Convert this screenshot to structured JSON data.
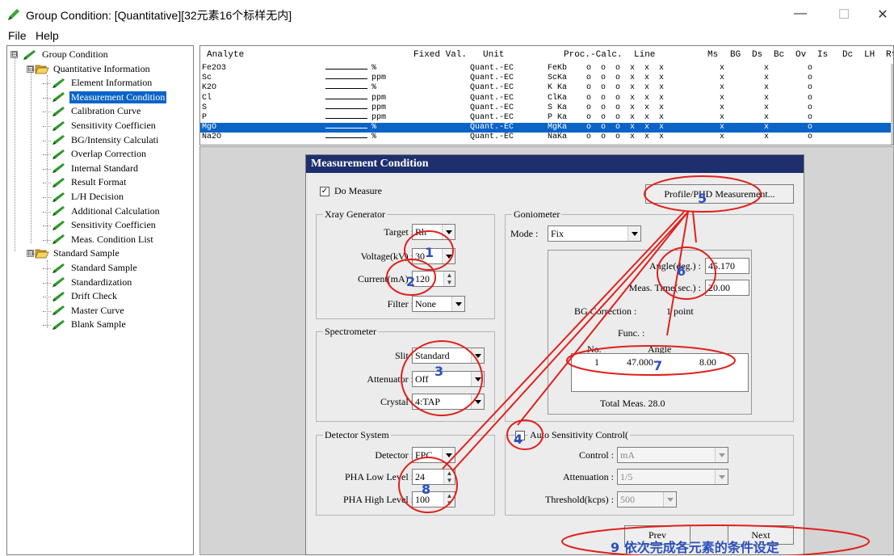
{
  "window": {
    "title": "Group Condition: [Quantitative][32元素16个标样无内]",
    "minimize": "—",
    "maximize": "☐",
    "close": "✕"
  },
  "menu": [
    "File",
    "Help"
  ],
  "tree": [
    {
      "label": "Group Condition",
      "icon": "pen-icon"
    },
    {
      "label": "Quantitative Information",
      "icon": "folder-open-icon"
    },
    {
      "label": "Element Information",
      "icon": "pen-icon"
    },
    {
      "label": "Measurement Condition",
      "icon": "pen-icon",
      "selected": true
    },
    {
      "label": "Calibration Curve",
      "icon": "pen-icon"
    },
    {
      "label": "Sensitivity Coefficien",
      "icon": "pen-icon"
    },
    {
      "label": "BG/Intensity Calculati",
      "icon": "pen-icon"
    },
    {
      "label": "Overlap Correction",
      "icon": "pen-icon"
    },
    {
      "label": "Internal Standard",
      "icon": "pen-icon"
    },
    {
      "label": "Result Format",
      "icon": "pen-icon"
    },
    {
      "label": "L/H Decision",
      "icon": "pen-icon"
    },
    {
      "label": "Additional Calculation",
      "icon": "pen-icon"
    },
    {
      "label": "Sensitivity Coefficien",
      "icon": "pen-icon"
    },
    {
      "label": "Meas. Condition List",
      "icon": "pen-icon"
    },
    {
      "label": "Standard Sample",
      "icon": "folder-open-icon"
    },
    {
      "label": "Standard Sample",
      "icon": "pen-icon"
    },
    {
      "label": "Standardization",
      "icon": "pen-icon"
    },
    {
      "label": "Drift Check",
      "icon": "pen-icon"
    },
    {
      "label": "Master Curve",
      "icon": "pen-icon"
    },
    {
      "label": "Blank Sample",
      "icon": "pen-icon"
    }
  ],
  "tree_expand": [
    "⊟",
    "⊟",
    "⊟"
  ],
  "grid": {
    "headers": [
      "Analyte",
      "Fixed Val.",
      "Unit",
      "Proc.-Calc.",
      "Line",
      "Ms",
      "BG",
      "Ds",
      "Bc",
      "Ov",
      "Is",
      "Dc",
      "LH",
      "Rf"
    ],
    "rows": [
      {
        "analyte": "Fe2O3",
        "unit": "%",
        "proc": "Quant.-EC",
        "line": "FeKb",
        "flags": "o  o  o  x  x  x",
        "ms": "x",
        "ds": "x",
        "ov": "o"
      },
      {
        "analyte": "Sc",
        "unit": "ppm",
        "proc": "Quant.-EC",
        "line": "ScKa",
        "flags": "o  o  o  x  x  x",
        "ms": "x",
        "ds": "x",
        "ov": "o"
      },
      {
        "analyte": "K2O",
        "unit": "%",
        "proc": "Quant.-EC",
        "line": "K Ka",
        "flags": "o  o  o  x  x  x",
        "ms": "x",
        "ds": "x",
        "ov": "o"
      },
      {
        "analyte": "Cl",
        "unit": "ppm",
        "proc": "Quant.-EC",
        "line": "ClKa",
        "flags": "o  o  o  x  x  x",
        "ms": "x",
        "ds": "x",
        "ov": "o"
      },
      {
        "analyte": "S",
        "unit": "ppm",
        "proc": "Quant.-EC",
        "line": "S Ka",
        "flags": "o  o  o  x  x  x",
        "ms": "x",
        "ds": "x",
        "ov": "o"
      },
      {
        "analyte": "P",
        "unit": "ppm",
        "proc": "Quant.-EC",
        "line": "P Ka",
        "flags": "o  o  o  x  x  x",
        "ms": "x",
        "ds": "x",
        "ov": "o"
      },
      {
        "analyte": "MgO",
        "unit": "%",
        "proc": "Quant.-EC",
        "line": "MgKa",
        "flags": "o  o  o  x  x  x",
        "ms": "x",
        "ds": "x",
        "ov": "o",
        "selected": true
      },
      {
        "analyte": "Na2O",
        "unit": "%",
        "proc": "Quant.-EC",
        "line": "NaKa",
        "flags": "o  o  o  x  x  x",
        "ms": "x",
        "ds": "x",
        "ov": "o"
      }
    ]
  },
  "dialog": {
    "title": "Measurement Condition",
    "do_measure_label": "Do Measure",
    "do_measure_checked": "✓",
    "profile_button": "Profile/PHD Measurement...",
    "xray": {
      "title": "Xray Generator",
      "target_label": "Target :",
      "target_value": "Rh",
      "voltage_label": "Voltage(kV) :",
      "voltage_value": "30",
      "current_label": "Current(mA) :",
      "current_value": "120",
      "filter_label": "Filter :",
      "filter_value": "None"
    },
    "spectrometer": {
      "title": "Spectrometer",
      "slit_label": "Slit :",
      "slit_value": "Standard",
      "attenuator_label": "Attenuator :",
      "attenuator_value": "Off",
      "crystal_label": "Crystal :",
      "crystal_value": "4:TAP"
    },
    "detector": {
      "title": "Detector System",
      "detector_label": "Detector :",
      "detector_value": "FPC",
      "pha_low_label": "PHA Low Level :",
      "pha_low_value": "24",
      "pha_high_label": "PHA High Level :",
      "pha_high_value": "100"
    },
    "goniometer": {
      "title": "Goniometer",
      "mode_label": "Mode :",
      "mode_value": "Fix",
      "angle_label": "Angle(deg.) :",
      "angle_value": "45.170",
      "meas_time_label": "Meas. Time(sec.) :",
      "meas_time_value": "20.00",
      "bg_corr_label": "BG Correction :",
      "bg_corr_value": "1 point",
      "func_label": "Func. :",
      "list_head_no": "No.",
      "list_head_angle": "Angle",
      "list_row_no": "1",
      "list_row_angle": "47.000",
      "list_row_time": "8.00",
      "total_meas": "Total Meas.  28.0"
    },
    "auto_sens": {
      "title": "Auto Sensitivity Control(",
      "control_label": "Control :",
      "control_value": "mA",
      "attenuation_label": "Attenuation :",
      "attenuation_value": "1/5",
      "threshold_label": "Threshold(kcps) :",
      "threshold_value": "500"
    },
    "prev_button": "Prev",
    "next_button": "Next"
  },
  "annotations": {
    "n1": "1",
    "n2": "2",
    "n3": "3",
    "n4": "4",
    "n5": "5",
    "n6": "6",
    "n7": "7",
    "n8": "8",
    "n9": "9 依次完成各元素的条件设定",
    "color": "#e0201c"
  }
}
